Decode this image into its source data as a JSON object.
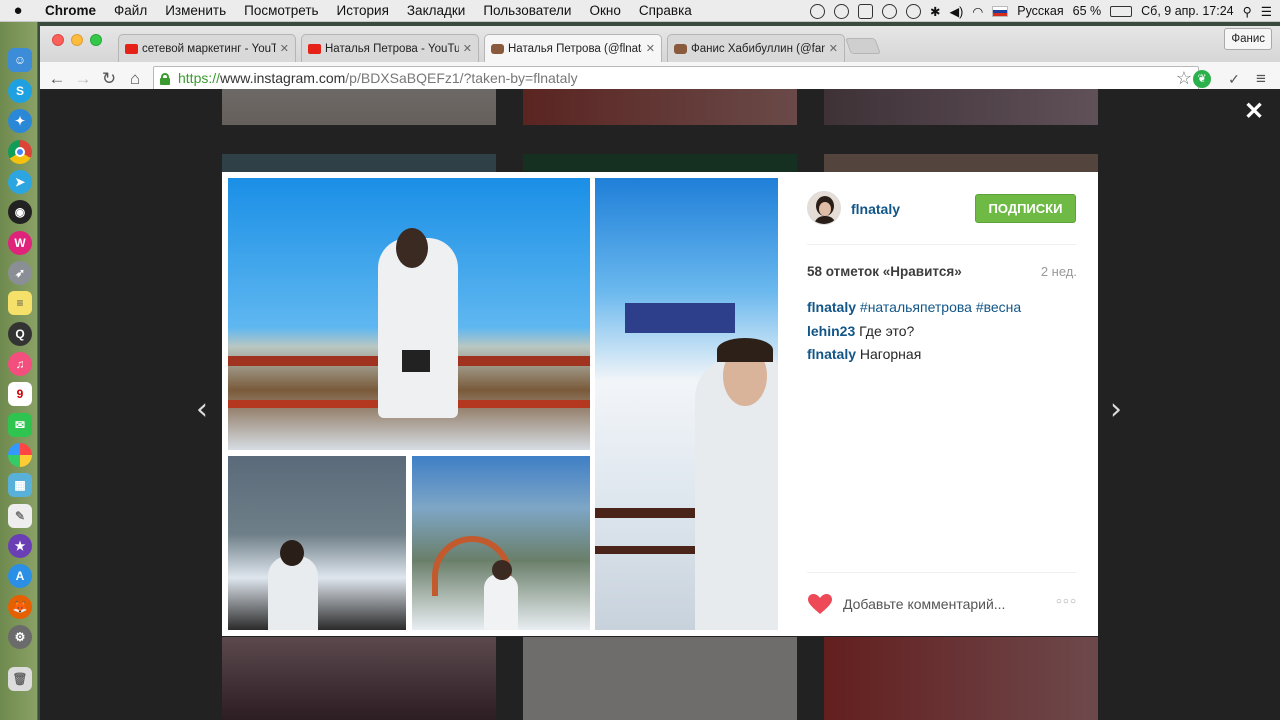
{
  "menubar": {
    "app_name": "Chrome",
    "items": [
      "Файл",
      "Изменить",
      "Посмотреть",
      "История",
      "Закладки",
      "Пользователи",
      "Окно",
      "Справка"
    ],
    "status": {
      "keyboard_layout": "Русская",
      "battery": "65 %",
      "datetime": "Сб, 9 апр.  17:24"
    }
  },
  "browser": {
    "profile_name": "Фанис",
    "tabs": [
      {
        "title": "сетевой маркетинг - YouTube",
        "favicon": "youtube-icon",
        "active": false
      },
      {
        "title": "Наталья Петрова - YouTube",
        "favicon": "youtube-icon",
        "active": false
      },
      {
        "title": "Наталья Петрова (@flnataly)",
        "favicon": "instagram-icon",
        "active": true
      },
      {
        "title": "Фанис Хабибуллин (@fanis)",
        "favicon": "instagram-icon",
        "active": false
      }
    ],
    "url": {
      "scheme": "https://",
      "host": "www.instagram.com",
      "path": "/p/BDXSaBQEFz1/?taken-by=flnataly"
    }
  },
  "post": {
    "username": "flnataly",
    "follow_label": "ПОДПИСКИ",
    "likes": "58 отметок «Нравится»",
    "time_ago": "2 нед.",
    "comments": [
      {
        "user": "flnataly",
        "text": "#натальяпетрова #весна"
      },
      {
        "user": "lehin23",
        "text": "Где это?"
      },
      {
        "user": "flnataly",
        "text": "Нагорная"
      }
    ],
    "add_comment_placeholder": "Добавьте комментарий...",
    "more_label": "○○○"
  },
  "controls": {
    "close": "✕",
    "prev": "‹",
    "next": "›"
  },
  "colors": {
    "follow_button": "#6fba45",
    "link": "#125688",
    "heart": "#ed4956"
  }
}
